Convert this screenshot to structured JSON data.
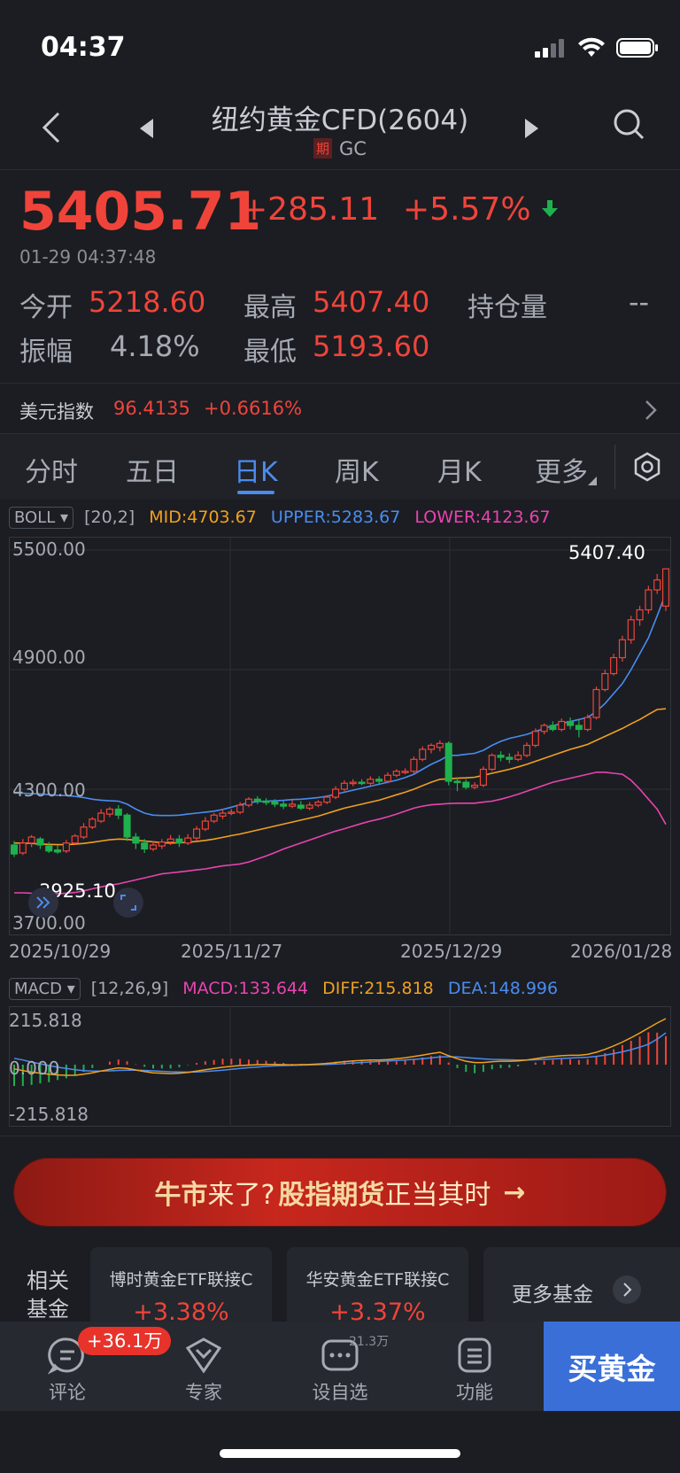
{
  "status_bar": {
    "time": "04:37"
  },
  "header": {
    "title": "纽约黄金CFD(2604)",
    "badge": "期",
    "code": "GC"
  },
  "quote": {
    "price": "5405.71",
    "change": "+285.11",
    "change_pct": "+5.57%",
    "timestamp": "01-29 04:37:48",
    "open_label": "今开",
    "open": "5218.60",
    "high_label": "最高",
    "high": "5407.40",
    "oi_label": "持仓量",
    "oi": "--",
    "amp_label": "振幅",
    "amp": "4.18%",
    "low_label": "最低",
    "low": "5193.60"
  },
  "usd_index": {
    "label": "美元指数",
    "value": "96.4135",
    "change": "+0.6616%"
  },
  "tabs": [
    "分时",
    "五日",
    "日K",
    "周K",
    "月K",
    "更多"
  ],
  "active_tab": "日K",
  "boll": {
    "name": "BOLL",
    "params": "[20,2]",
    "mid": "MID:4703.67",
    "upper": "UPPER:5283.67",
    "lower": "LOWER:4123.67"
  },
  "macd": {
    "name": "MACD",
    "params": "[12,26,9]",
    "macd": "MACD:133.644",
    "diff": "DIFF:215.818",
    "dea": "DEA:148.996"
  },
  "chart_data": [
    {
      "type": "candlestick",
      "y_ticks": [
        "5500.00",
        "4900.00",
        "4300.00",
        "3700.00"
      ],
      "ylim": [
        3700,
        5500
      ],
      "x_ticks": [
        "2025/10/29",
        "2025/11/27",
        "2025/12/29",
        "2026/01/28"
      ],
      "max_label": "5407.40",
      "min_label": "3925.10",
      "candles": [
        [
          4020,
          3975,
          4040,
          3960
        ],
        [
          3980,
          4030,
          4050,
          3970
        ],
        [
          4030,
          4060,
          4070,
          4010
        ],
        [
          4050,
          4020,
          4060,
          4000
        ],
        [
          4015,
          3990,
          4035,
          3980
        ],
        [
          3995,
          3985,
          4020,
          3975
        ],
        [
          3990,
          4030,
          4045,
          3980
        ],
        [
          4030,
          4065,
          4075,
          4020
        ],
        [
          4060,
          4110,
          4130,
          4050
        ],
        [
          4110,
          4150,
          4160,
          4100
        ],
        [
          4140,
          4180,
          4200,
          4130
        ],
        [
          4175,
          4200,
          4210,
          4160
        ],
        [
          4200,
          4170,
          4220,
          4150
        ],
        [
          4170,
          4060,
          4180,
          4040
        ],
        [
          4060,
          4030,
          4080,
          4000
        ],
        [
          4030,
          4000,
          4050,
          3980
        ],
        [
          4000,
          4020,
          4040,
          3990
        ],
        [
          4015,
          4035,
          4050,
          4000
        ],
        [
          4035,
          4050,
          4070,
          4020
        ],
        [
          4050,
          4030,
          4070,
          4010
        ],
        [
          4030,
          4055,
          4075,
          4020
        ],
        [
          4055,
          4100,
          4115,
          4040
        ],
        [
          4100,
          4140,
          4160,
          4090
        ],
        [
          4140,
          4170,
          4180,
          4130
        ],
        [
          4165,
          4180,
          4195,
          4150
        ],
        [
          4180,
          4185,
          4200,
          4170
        ],
        [
          4185,
          4220,
          4235,
          4175
        ],
        [
          4220,
          4250,
          4260,
          4210
        ],
        [
          4250,
          4240,
          4265,
          4225
        ],
        [
          4240,
          4235,
          4255,
          4220
        ],
        [
          4235,
          4225,
          4250,
          4210
        ],
        [
          4225,
          4215,
          4240,
          4200
        ],
        [
          4215,
          4225,
          4245,
          4205
        ],
        [
          4220,
          4205,
          4240,
          4195
        ],
        [
          4205,
          4220,
          4235,
          4195
        ],
        [
          4220,
          4235,
          4245,
          4210
        ],
        [
          4235,
          4260,
          4270,
          4225
        ],
        [
          4260,
          4300,
          4315,
          4250
        ],
        [
          4300,
          4330,
          4345,
          4290
        ],
        [
          4330,
          4335,
          4350,
          4315
        ],
        [
          4335,
          4330,
          4350,
          4320
        ],
        [
          4330,
          4350,
          4365,
          4320
        ],
        [
          4350,
          4340,
          4365,
          4325
        ],
        [
          4340,
          4370,
          4385,
          4330
        ],
        [
          4370,
          4390,
          4400,
          4360
        ],
        [
          4390,
          4390,
          4405,
          4375
        ],
        [
          4390,
          4450,
          4465,
          4380
        ],
        [
          4450,
          4500,
          4515,
          4440
        ],
        [
          4500,
          4520,
          4530,
          4480
        ],
        [
          4510,
          4530,
          4545,
          4490
        ],
        [
          4530,
          4340,
          4540,
          4320
        ],
        [
          4340,
          4335,
          4360,
          4290
        ],
        [
          4335,
          4310,
          4350,
          4300
        ],
        [
          4310,
          4320,
          4335,
          4300
        ],
        [
          4320,
          4400,
          4415,
          4310
        ],
        [
          4400,
          4470,
          4480,
          4390
        ],
        [
          4470,
          4460,
          4490,
          4440
        ],
        [
          4460,
          4450,
          4480,
          4430
        ],
        [
          4450,
          4470,
          4490,
          4440
        ],
        [
          4470,
          4520,
          4535,
          4460
        ],
        [
          4520,
          4590,
          4605,
          4510
        ],
        [
          4590,
          4620,
          4630,
          4575
        ],
        [
          4620,
          4600,
          4640,
          4590
        ],
        [
          4600,
          4640,
          4655,
          4590
        ],
        [
          4640,
          4620,
          4660,
          4600
        ],
        [
          4620,
          4600,
          4650,
          4560
        ],
        [
          4600,
          4660,
          4675,
          4590
        ],
        [
          4660,
          4800,
          4815,
          4650
        ],
        [
          4800,
          4880,
          4900,
          4790
        ],
        [
          4880,
          4960,
          4980,
          4870
        ],
        [
          4960,
          5050,
          5070,
          4940
        ],
        [
          5050,
          5150,
          5170,
          5030
        ],
        [
          5150,
          5200,
          5220,
          5120
        ],
        [
          5200,
          5300,
          5320,
          5180
        ],
        [
          5300,
          5350,
          5380,
          5280
        ],
        [
          5218.6,
          5405.71,
          5407.4,
          5193.6
        ]
      ],
      "boll_mid": [
        4030,
        4030,
        4028,
        4025,
        4023,
        4022,
        4022,
        4024,
        4028,
        4034,
        4040,
        4046,
        4050,
        4048,
        4044,
        4040,
        4036,
        4032,
        4030,
        4031,
        4034,
        4038,
        4043,
        4050,
        4058,
        4067,
        4075,
        4085,
        4095,
        4105,
        4115,
        4125,
        4135,
        4145,
        4155,
        4165,
        4178,
        4192,
        4205,
        4215,
        4225,
        4235,
        4245,
        4258,
        4272,
        4285,
        4300,
        4318,
        4335,
        4350,
        4352,
        4355,
        4357,
        4360,
        4370,
        4380,
        4390,
        4400,
        4412,
        4425,
        4440,
        4455,
        4470,
        4485,
        4500,
        4512,
        4525,
        4545,
        4565,
        4585,
        4605,
        4628,
        4650,
        4675,
        4700,
        4703.67
      ],
      "boll_upper": [
        4280,
        4280,
        4278,
        4276,
        4273,
        4270,
        4268,
        4264,
        4258,
        4250,
        4245,
        4242,
        4240,
        4225,
        4200,
        4180,
        4170,
        4168,
        4168,
        4170,
        4175,
        4180,
        4185,
        4190,
        4198,
        4210,
        4222,
        4232,
        4238,
        4240,
        4242,
        4244,
        4248,
        4250,
        4254,
        4258,
        4265,
        4275,
        4285,
        4295,
        4305,
        4315,
        4325,
        4335,
        4345,
        4358,
        4375,
        4400,
        4425,
        4445,
        4470,
        4470,
        4475,
        4480,
        4495,
        4520,
        4540,
        4555,
        4565,
        4575,
        4590,
        4605,
        4618,
        4630,
        4640,
        4650,
        4660,
        4690,
        4730,
        4780,
        4830,
        4900,
        4980,
        5060,
        5170,
        5283.67
      ],
      "boll_lower": [
        3780,
        3780,
        3778,
        3776,
        3775,
        3776,
        3778,
        3782,
        3790,
        3800,
        3810,
        3818,
        3825,
        3835,
        3845,
        3855,
        3865,
        3875,
        3880,
        3885,
        3890,
        3895,
        3900,
        3908,
        3915,
        3920,
        3925,
        3935,
        3950,
        3965,
        3982,
        4000,
        4015,
        4030,
        4045,
        4060,
        4075,
        4090,
        4102,
        4115,
        4128,
        4140,
        4150,
        4162,
        4175,
        4190,
        4205,
        4215,
        4222,
        4225,
        4228,
        4230,
        4230,
        4230,
        4235,
        4240,
        4250,
        4262,
        4275,
        4290,
        4305,
        4320,
        4335,
        4345,
        4355,
        4365,
        4375,
        4385,
        4385,
        4380,
        4375,
        4345,
        4300,
        4250,
        4200,
        4123.67
      ]
    },
    {
      "type": "macd",
      "y_ticks": [
        "215.818",
        "0.000",
        "-215.818"
      ],
      "ylim": [
        -215.818,
        215.818
      ],
      "diff": [
        -20,
        -28,
        -35,
        -40,
        -45,
        -48,
        -50,
        -50,
        -45,
        -38,
        -30,
        -22,
        -15,
        -18,
        -25,
        -32,
        -38,
        -40,
        -42,
        -40,
        -36,
        -30,
        -24,
        -18,
        -12,
        -8,
        -4,
        -2,
        0,
        1,
        1,
        0,
        -1,
        0,
        1,
        3,
        6,
        10,
        14,
        18,
        20,
        22,
        22,
        24,
        28,
        32,
        38,
        45,
        52,
        58,
        42,
        28,
        16,
        10,
        10,
        14,
        16,
        16,
        18,
        22,
        28,
        34,
        38,
        42,
        44,
        44,
        48,
        58,
        72,
        88,
        106,
        126,
        148,
        172,
        195,
        215.818
      ],
      "dea": [
        30,
        22,
        12,
        4,
        -4,
        -12,
        -18,
        -24,
        -28,
        -30,
        -30,
        -29,
        -27,
        -26,
        -26,
        -27,
        -29,
        -31,
        -33,
        -34,
        -35,
        -34,
        -32,
        -29,
        -26,
        -22,
        -18,
        -14,
        -11,
        -8,
        -6,
        -4,
        -3,
        -2,
        -1,
        0,
        1,
        3,
        5,
        8,
        10,
        13,
        15,
        17,
        20,
        22,
        25,
        28,
        32,
        36,
        37,
        36,
        33,
        30,
        27,
        25,
        24,
        23,
        22,
        22,
        23,
        25,
        27,
        29,
        31,
        33,
        35,
        39,
        45,
        52,
        60,
        70,
        82,
        96,
        120,
        148.996
      ],
      "hist": [
        -100,
        -100,
        -95,
        -88,
        -82,
        -72,
        -64,
        -52,
        -34,
        -16,
        0,
        14,
        24,
        16,
        2,
        -10,
        -18,
        -18,
        -18,
        -12,
        -2,
        8,
        16,
        22,
        28,
        28,
        28,
        24,
        22,
        18,
        14,
        8,
        4,
        4,
        4,
        6,
        10,
        14,
        18,
        20,
        20,
        18,
        14,
        14,
        16,
        20,
        26,
        34,
        40,
        44,
        10,
        -16,
        -34,
        -40,
        -34,
        -22,
        -16,
        -14,
        -8,
        0,
        10,
        18,
        22,
        26,
        26,
        22,
        26,
        38,
        54,
        72,
        92,
        112,
        132,
        152,
        150,
        133.644
      ]
    }
  ],
  "banner": {
    "part1": "牛市",
    "part2": "来了?",
    "part3": "股指期货",
    "part4": "正当其时",
    "arrow": "→"
  },
  "funds": {
    "title": "相关基金",
    "items": [
      {
        "name": "博时黄金ETF联接C",
        "pct": "+3.38%"
      },
      {
        "name": "华安黄金ETF联接C",
        "pct": "+3.37%"
      }
    ],
    "more": "更多基金"
  },
  "bottom_nav": {
    "comment": "评论",
    "comment_badge": "+36.1万",
    "expert": "专家",
    "watch": "设自选",
    "watch_count": "21.3万",
    "function": "功能",
    "buy": "买黄金"
  }
}
